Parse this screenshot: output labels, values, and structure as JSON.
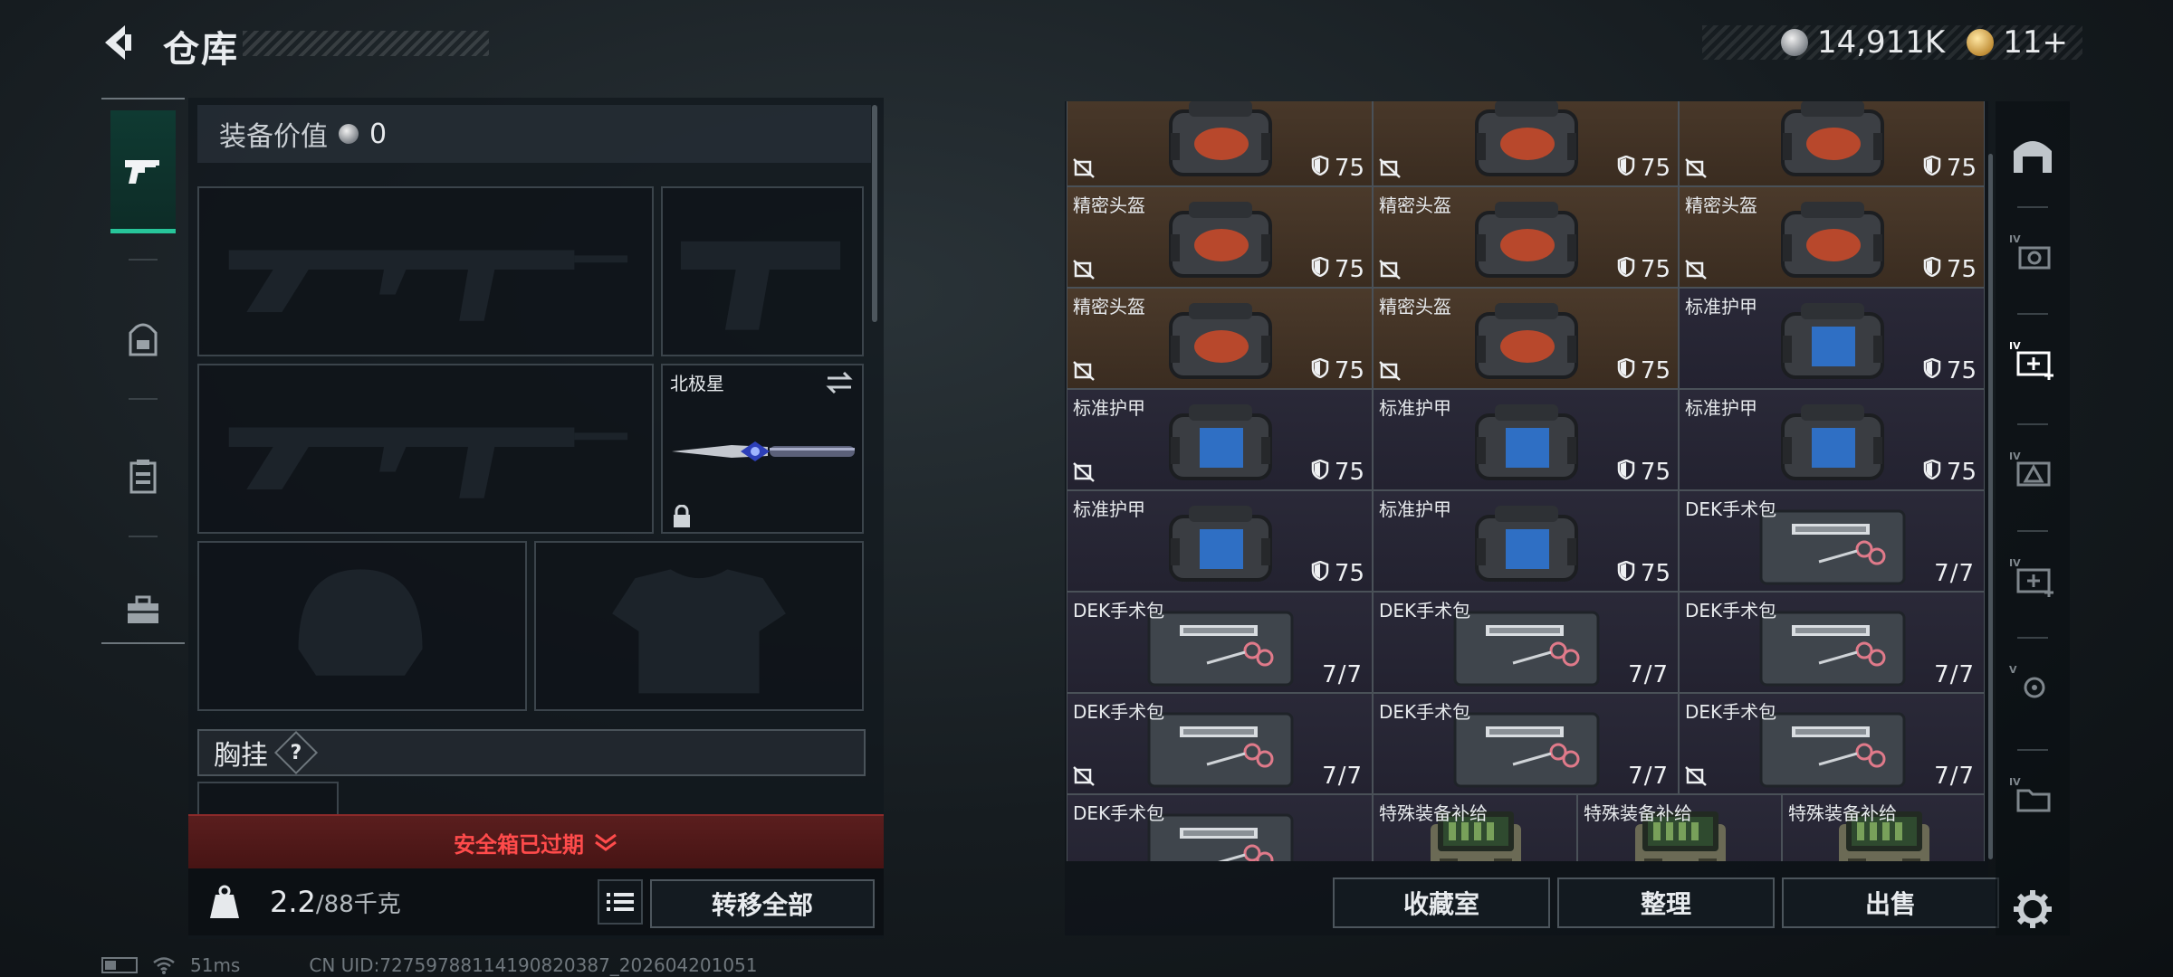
{
  "header": {
    "title": "仓库",
    "currencies": [
      {
        "icon": "silver-coin-icon",
        "value": "14,911K"
      },
      {
        "icon": "gold-coin-icon",
        "value": "11+"
      }
    ]
  },
  "left_rail": {
    "items": [
      {
        "name": "weapons",
        "icon": "pistol-icon",
        "active": true
      },
      {
        "name": "backpack",
        "icon": "backpack-icon",
        "active": false
      },
      {
        "name": "chest-rig",
        "icon": "chest-rig-icon",
        "active": false
      },
      {
        "name": "toolbox",
        "icon": "toolbox-icon",
        "active": false
      }
    ]
  },
  "equipment": {
    "value_label": "装备价值",
    "value": "0",
    "melee_name": "北极星",
    "chest_label": "胸挂",
    "chest_help": "?"
  },
  "safebox": {
    "label": "安全箱已过期"
  },
  "weight": {
    "current": "2.2",
    "capacity": "/88千克"
  },
  "buttons": {
    "transfer_all": "转移全部",
    "collection": "收藏室",
    "organize": "整理",
    "sell": "出售"
  },
  "storage": {
    "rows": [
      [
        {
          "name": "",
          "type": "helmet",
          "durability": "75",
          "insured": false,
          "bg": "brown"
        },
        {
          "name": "",
          "type": "helmet",
          "durability": "75",
          "insured": false,
          "bg": "brown"
        },
        {
          "name": "",
          "type": "helmet",
          "durability": "75",
          "insured": false,
          "bg": "brown"
        }
      ],
      [
        {
          "name": "精密头盔",
          "type": "helmet",
          "durability": "75",
          "insured": false,
          "bg": "brown"
        },
        {
          "name": "精密头盔",
          "type": "helmet",
          "durability": "75",
          "insured": false,
          "bg": "brown"
        },
        {
          "name": "精密头盔",
          "type": "helmet",
          "durability": "75",
          "insured": false,
          "bg": "brown"
        }
      ],
      [
        {
          "name": "精密头盔",
          "type": "helmet",
          "durability": "75",
          "insured": false,
          "bg": "brown"
        },
        {
          "name": "精密头盔",
          "type": "helmet",
          "durability": "75",
          "insured": false,
          "bg": "brown"
        },
        {
          "name": "标准护甲",
          "type": "armor",
          "durability": "75",
          "insured": true,
          "bg": "violet"
        }
      ],
      [
        {
          "name": "标准护甲",
          "type": "armor",
          "durability": "75",
          "insured": false,
          "bg": "violet"
        },
        {
          "name": "标准护甲",
          "type": "armor",
          "durability": "75",
          "insured": true,
          "bg": "violet"
        },
        {
          "name": "标准护甲",
          "type": "armor",
          "durability": "75",
          "insured": true,
          "bg": "violet"
        }
      ],
      [
        {
          "name": "标准护甲",
          "type": "armor",
          "durability": "75",
          "insured": true,
          "bg": "violet"
        },
        {
          "name": "标准护甲",
          "type": "armor",
          "durability": "75",
          "insured": true,
          "bg": "violet"
        },
        {
          "name": "DEK手术包",
          "type": "medkit",
          "stack": "7/7",
          "insured": true,
          "bg": "violet"
        }
      ],
      [
        {
          "name": "DEK手术包",
          "type": "medkit",
          "stack": "7/7",
          "insured": true,
          "bg": "violet"
        },
        {
          "name": "DEK手术包",
          "type": "medkit",
          "stack": "7/7",
          "insured": true,
          "bg": "violet"
        },
        {
          "name": "DEK手术包",
          "type": "medkit",
          "stack": "7/7",
          "insured": true,
          "bg": "violet"
        }
      ],
      [
        {
          "name": "DEK手术包",
          "type": "medkit",
          "stack": "7/7",
          "insured": false,
          "bg": "violet"
        },
        {
          "name": "DEK手术包",
          "type": "medkit",
          "stack": "7/7",
          "insured": true,
          "bg": "violet"
        },
        {
          "name": "DEK手术包",
          "type": "medkit",
          "stack": "7/7",
          "insured": false,
          "bg": "violet"
        }
      ]
    ],
    "last_row": [
      {
        "name": "DEK手术包",
        "type": "medkit",
        "stack": "7/7",
        "bg": "violet"
      },
      {
        "name": "特殊装备补给",
        "type": "supply",
        "bg": "violet"
      },
      {
        "name": "特殊装备补给",
        "type": "supply",
        "bg": "violet"
      },
      {
        "name": "特殊装备补给",
        "type": "supply",
        "bg": "violet"
      }
    ]
  },
  "right_rail": {
    "tabs": [
      {
        "icon": "storage-home-icon",
        "label": ""
      },
      {
        "icon": "tier4-camera-icon",
        "label": "IV"
      },
      {
        "icon": "tier4-medkit-icon",
        "label": "IV",
        "active": true
      },
      {
        "icon": "tier4-warning-icon",
        "label": "IV"
      },
      {
        "icon": "tier4-medkit-add-icon",
        "label": "IV"
      },
      {
        "icon": "tier5-gear-icon",
        "label": "V"
      },
      {
        "icon": "tier4-folder-icon",
        "label": "IV"
      },
      {
        "icon": "settings-gear-icon",
        "label": ""
      }
    ]
  },
  "status": {
    "ping": "51ms",
    "uid": "CN UID:72759788114190820387_202604201051"
  }
}
